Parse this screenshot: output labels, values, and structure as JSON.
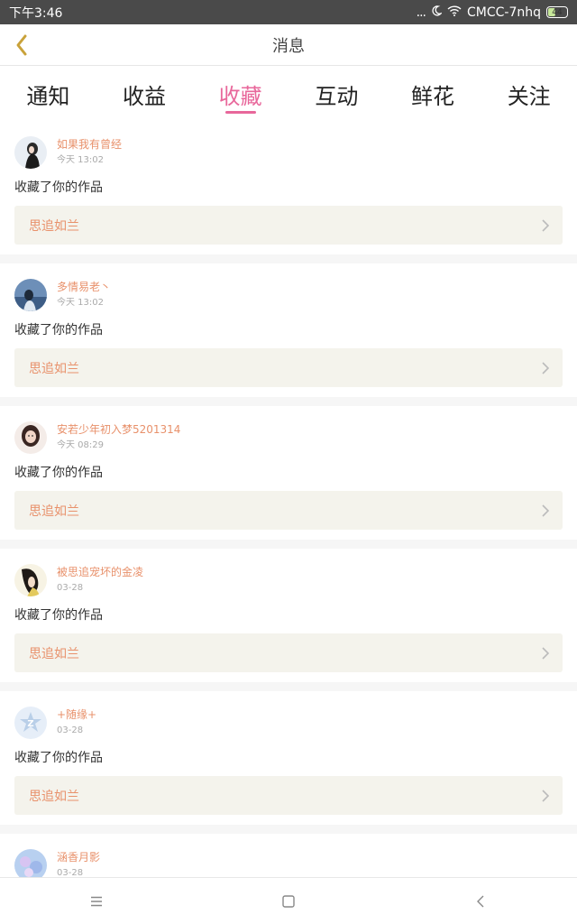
{
  "status_bar": {
    "time": "下午3:46",
    "dots": "...",
    "network": "CMCC-7nhq",
    "battery": "44",
    "battery_level": 0.44
  },
  "header": {
    "title": "消息",
    "back_icon": "chevron-left-icon",
    "accent_color": "#c9a23a"
  },
  "tabs": [
    {
      "label": "通知",
      "active": false
    },
    {
      "label": "收益",
      "active": false
    },
    {
      "label": "收藏",
      "active": true
    },
    {
      "label": "互动",
      "active": false
    },
    {
      "label": "鲜花",
      "active": false
    },
    {
      "label": "关注",
      "active": false
    }
  ],
  "colors": {
    "tab_active": "#e8679b",
    "username": "#e8916b",
    "work_bg": "#f4f3ec"
  },
  "items": [
    {
      "user": "如果我有曾经",
      "time": "今天 13:02",
      "action": "收藏了你的作品",
      "work": "思追如兰"
    },
    {
      "user": "多情易老丶",
      "time": "今天 13:02",
      "action": "收藏了你的作品",
      "work": "思追如兰"
    },
    {
      "user": "安若少年初入梦5201314",
      "time": "今天 08:29",
      "action": "收藏了你的作品",
      "work": "思追如兰"
    },
    {
      "user": "被思追宠坏的金凌",
      "time": "03-28",
      "action": "收藏了你的作品",
      "work": "思追如兰"
    },
    {
      "user": "+随缘+",
      "time": "03-28",
      "action": "收藏了你的作品",
      "work": "思追如兰"
    },
    {
      "user": "涵香月影",
      "time": "03-28",
      "action": "",
      "work": ""
    }
  ],
  "nav": {
    "menu_icon": "menu-icon",
    "home_icon": "square-home-icon",
    "back_icon": "triangle-back-icon"
  }
}
